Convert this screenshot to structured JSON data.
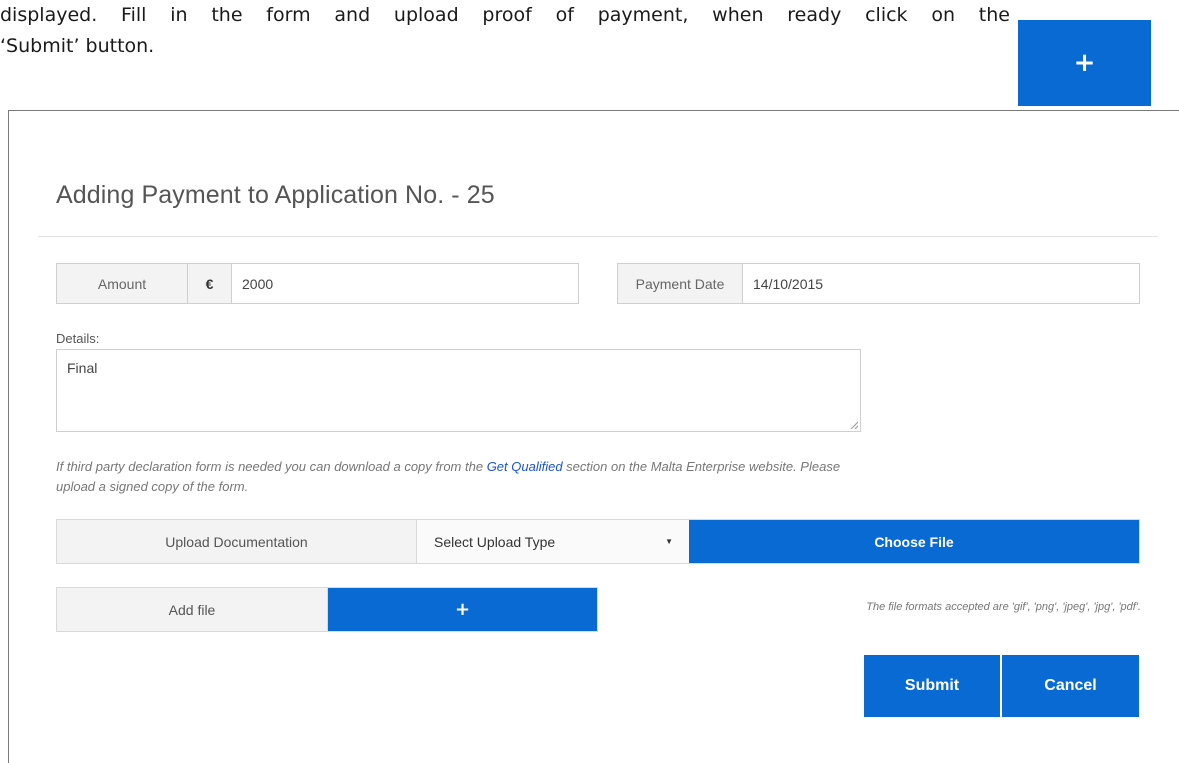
{
  "document": {
    "line1": "displayed. Fill in the form and upload proof of payment, when ready click on the",
    "line2": "‘Submit’ button."
  },
  "corner_add_button": {
    "icon": "plus-icon",
    "label": "+"
  },
  "modal": {
    "title": "Adding Payment to Application No. - 25",
    "amount": {
      "label": "Amount",
      "currency": "€",
      "value": "2000"
    },
    "payment_date": {
      "label": "Payment Date",
      "value": "14/10/2015"
    },
    "details": {
      "label": "Details:",
      "value": "Final"
    },
    "hint": {
      "before_link": "If third party declaration form is needed you can download a copy from the ",
      "link": "Get Qualified",
      "after_link": " section on the Malta Enterprise website. Please upload a signed copy of the form."
    },
    "upload": {
      "label": "Upload Documentation",
      "select_value": "Select Upload Type",
      "choose_button": "Choose File"
    },
    "add_file": {
      "label": "Add file",
      "button_icon": "plus-icon",
      "button_label": "+"
    },
    "formats_note": "The file formats accepted are 'gif', 'png', 'jpeg', 'jpg', 'pdf'.",
    "actions": {
      "submit": "Submit",
      "cancel": "Cancel"
    }
  },
  "colors": {
    "accent": "#0a6ad3",
    "link": "#1a55c9",
    "addon_bg": "#f3f3f3"
  }
}
